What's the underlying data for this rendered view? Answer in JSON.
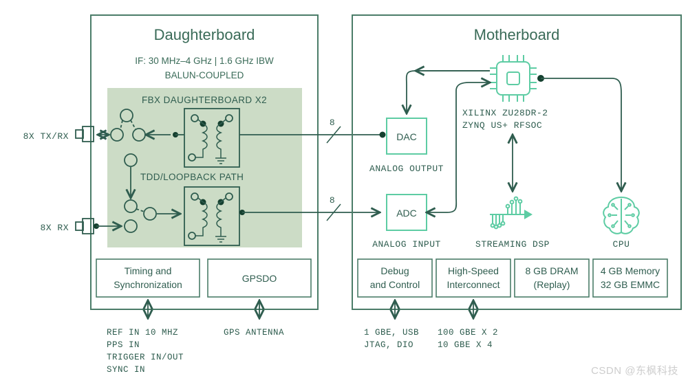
{
  "watermark": "CSDN @东枫科技",
  "daughterboard": {
    "title": "Daughterboard",
    "subtitle_line1": "IF: 30 MHz–4 GHz  |  1.6 GHz IBW",
    "subtitle_line2": "BALUN-COUPLED",
    "panel_label": "FBX DAUGHTERBOARD X2",
    "loopback_label": "TDD/LOOPBACK PATH",
    "ports": [
      {
        "label": "8X TX/RX",
        "direction": "bidirectional"
      },
      {
        "label": "8X RX",
        "direction": "input"
      }
    ],
    "sub_blocks": [
      {
        "line1": "Timing and",
        "line2": "Synchronization"
      },
      {
        "line1": "GPSDO",
        "line2": ""
      }
    ],
    "io_labels": [
      {
        "lines": [
          "REF IN 10 MHZ",
          "PPS IN",
          "TRIGGER IN/OUT",
          "SYNC IN"
        ]
      },
      {
        "lines": [
          "GPS ANTENNA"
        ]
      }
    ]
  },
  "motherboard": {
    "title": "Motherboard",
    "converters": [
      {
        "name": "DAC",
        "caption": "ANALOG OUTPUT",
        "bus_width": "8"
      },
      {
        "name": "ADC",
        "caption": "ANALOG INPUT",
        "bus_width": "8"
      }
    ],
    "soc": {
      "icon": "chip-icon",
      "line1": "XILINX ZU28DR-2",
      "line2": "ZYNQ US+ RFSOC"
    },
    "engines": [
      {
        "icon": "dsp-signal-icon",
        "label": "STREAMING DSP"
      },
      {
        "icon": "brain-icon",
        "label": "CPU"
      }
    ],
    "sub_blocks": [
      {
        "line1": "Debug",
        "line2": "and Control"
      },
      {
        "line1": "High-Speed",
        "line2": "Interconnect"
      },
      {
        "line1": "8 GB DRAM",
        "line2": "(Replay)"
      },
      {
        "line1": "4 GB Memory",
        "line2": "32 GB EMMC"
      }
    ],
    "io_labels": [
      {
        "lines": [
          "1 GBE, USB",
          "JTAG, DIO"
        ]
      },
      {
        "lines": [
          "100 GBE X 2",
          "10 GBE X 4"
        ]
      }
    ]
  },
  "colors": {
    "board_border": "#4A7C68",
    "dark_line": "#2F5D4F",
    "accent": "#5DCCA3",
    "panel_bg": "#CCDCC6"
  }
}
